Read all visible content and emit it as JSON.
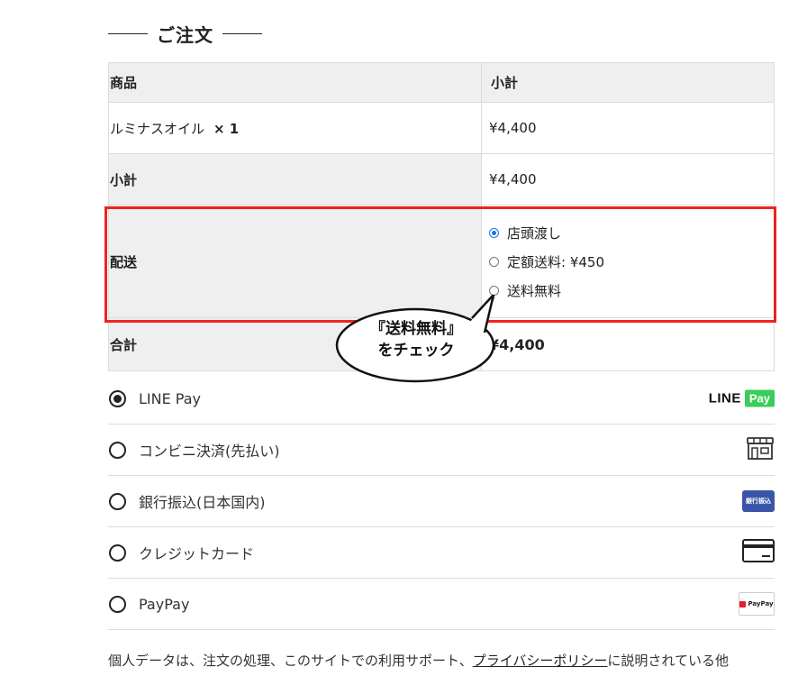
{
  "section": {
    "title": "ご注文"
  },
  "table": {
    "headers": {
      "product": "商品",
      "subtotal": "小計"
    },
    "item": {
      "name": "ルミナスオイル",
      "qty": "× 1",
      "price": "¥4,400"
    },
    "subtotal": {
      "label": "小計",
      "value": "¥4,400"
    },
    "shipping": {
      "label": "配送",
      "options": [
        {
          "label": "店頭渡し",
          "selected": true
        },
        {
          "label": "定額送料: ¥450",
          "selected": false
        },
        {
          "label": "送料無料",
          "selected": false
        }
      ]
    },
    "total": {
      "label": "合計",
      "value": "¥4,400"
    }
  },
  "callout": {
    "line1": "『送料無料』",
    "line2": "をチェック"
  },
  "payment": [
    {
      "label": "LINE Pay",
      "selected": true,
      "icon": "line-pay-logo"
    },
    {
      "label": "コンビニ決済(先払い)",
      "selected": false,
      "icon": "convenience-store-icon"
    },
    {
      "label": "銀行振込(日本国内)",
      "selected": false,
      "icon": "bank-transfer-icon"
    },
    {
      "label": "クレジットカード",
      "selected": false,
      "icon": "credit-card-icon"
    },
    {
      "label": "PayPay",
      "selected": false,
      "icon": "paypay-icon"
    }
  ],
  "icons": {
    "line_word": "LINE",
    "line_pay": "Pay",
    "bank_text": "銀行振込",
    "paypay_text": "PayPay"
  },
  "privacy": {
    "before": "個人データは、注文の処理、このサイトでの利用サポート、",
    "link": "プライバシーポリシー",
    "after": "に説明されている他"
  },
  "colors": {
    "highlight": "#f0231d",
    "line_green": "#3acd5a",
    "bank_blue": "#3a55a7",
    "radio_blue": "#1a73e8"
  }
}
